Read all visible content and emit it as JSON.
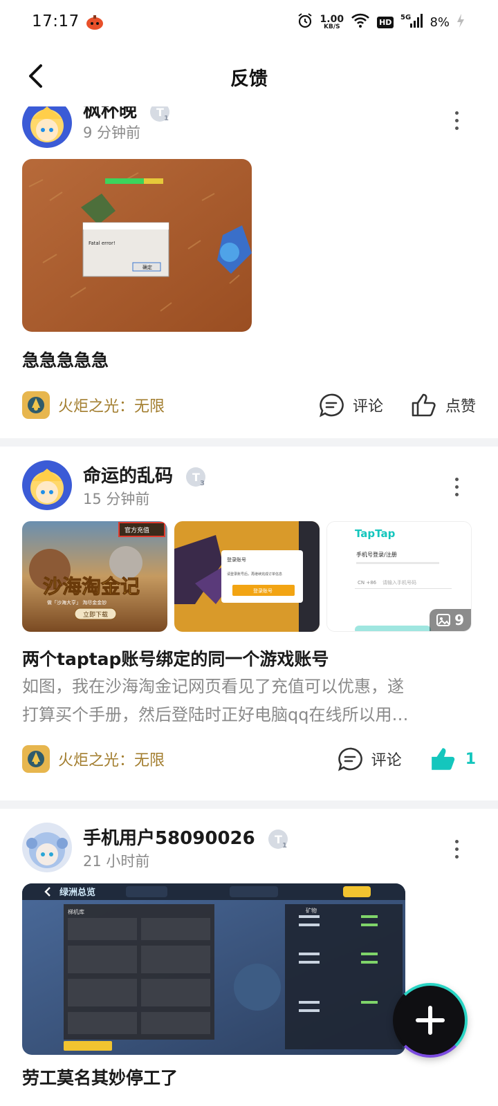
{
  "status_bar": {
    "time": "17:17",
    "net_speed": "1.00",
    "net_unit": "KB/S",
    "hd": "HD",
    "network": "5G",
    "battery": "8%"
  },
  "nav": {
    "title": "反馈",
    "back_icon": "chevron-left-icon"
  },
  "posts": [
    {
      "author": "枫杯晚",
      "level": "1",
      "time": "9 分钟前",
      "images": [
        {
          "dialog_text": "Fatal error!",
          "dialog_btn": "确定"
        }
      ],
      "title": "急急急急急",
      "game": "火炬之光：无限",
      "comment_label": "评论",
      "like_label": "点赞",
      "liked": false
    },
    {
      "author": "命运的乱码",
      "level": "3",
      "time": "15 分钟前",
      "images": [
        {
          "banner": "沙海淘金记",
          "sub": "做「沙海大亨」 淘尽金金钞",
          "cta": "立即下载",
          "tag": "官方充值"
        },
        {
          "dialog_title": "登录账号",
          "dialog_text": "请登录账号后，再继续完成订单信息",
          "dialog_btn": "登录账号"
        },
        {
          "brand": "TapTap",
          "heading": "手机号登录/注册",
          "phone_placeholder": "请输入手机号码",
          "country": "CN +86"
        }
      ],
      "more_images": "9",
      "title": "两个taptap账号绑定的同一个游戏账号",
      "body_lines": [
        "如图，我在沙海淘金记网页看见了充值可以优惠，遂",
        "打算买个手册，然后登陆时正好电脑qq在线所以用…"
      ],
      "game": "火炬之光：无限",
      "comment_label": "评论",
      "like_count": "1",
      "liked": true
    },
    {
      "author": "手机用户58090026",
      "level": "1",
      "time": "21 小时前",
      "images": [
        {
          "header": "绿洲总览",
          "section": "梯机库",
          "right_title": "矿物"
        }
      ],
      "title": "劳工莫名其妙停工了"
    }
  ],
  "fab": {
    "icon": "plus-icon"
  },
  "colors": {
    "accent": "#14c6bd",
    "game_name": "#a27d2e",
    "muted": "#8a8a8a"
  }
}
